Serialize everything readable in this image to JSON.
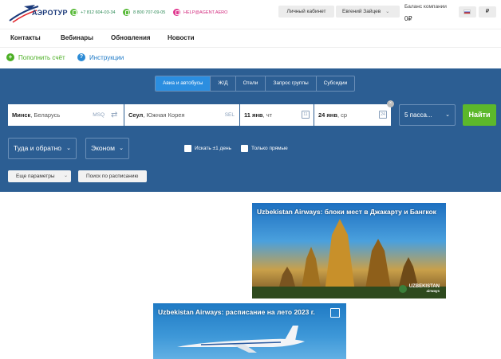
{
  "header": {
    "logo_text": "АЭРОТУР",
    "phone1": "+7 812 604-03-34",
    "phone2": "8 800 707-09-05",
    "email": "HELP@AGENT.AERO",
    "cabinet_label": "Личный кабинет",
    "user_name": "Евгений Зайцев",
    "balance_label": "Баланс компании",
    "balance_value": "0₽",
    "currency": "₽"
  },
  "nav": {
    "items": [
      {
        "label": "Контакты"
      },
      {
        "label": "Вебинары"
      },
      {
        "label": "Обновления"
      },
      {
        "label": "Новости"
      }
    ]
  },
  "actions": {
    "top_up": "Пополнить счёт",
    "instructions": "Инструкции"
  },
  "search": {
    "tabs": [
      {
        "label": "Авиа и автобусы",
        "active": true
      },
      {
        "label": "Ж/Д"
      },
      {
        "label": "Отели"
      },
      {
        "label": "Запрос группы"
      },
      {
        "label": "Субсидии"
      }
    ],
    "from_city": "Минск",
    "from_country": ", Беларусь",
    "from_code": "MSQ",
    "to_city": "Сеул",
    "to_country": ", Южная Корея",
    "to_code": "SEL",
    "date_from": "11 янв",
    "date_from_day": ", чт",
    "date_from_cal": "11",
    "date_to": "24 янв",
    "date_to_day": ", ср",
    "date_to_cal": "24",
    "passengers": "5 пасса...",
    "find_label": "Найти",
    "trip_type": "Туда и обратно",
    "cabin_class": "Эконом",
    "flex_dates_label": "Искать ±1 день",
    "direct_label": "Только прямые",
    "more_params": "Еще параметры",
    "schedule_search": "Поиск по расписанию"
  },
  "banners": [
    {
      "title": "Uzbekistan Airways: блоки мест в Джакарту и Бангкок",
      "badge": "UZBEKISTAN",
      "badge_sub": "airways"
    },
    {
      "title": "Uzbekistan Airways: расписание на лето 2023 г."
    }
  ],
  "colors": {
    "panel_bg": "#2c5e93",
    "active_tab": "#2b8ee0",
    "find_button": "#5cb82b",
    "accent_green": "#4caf25"
  }
}
